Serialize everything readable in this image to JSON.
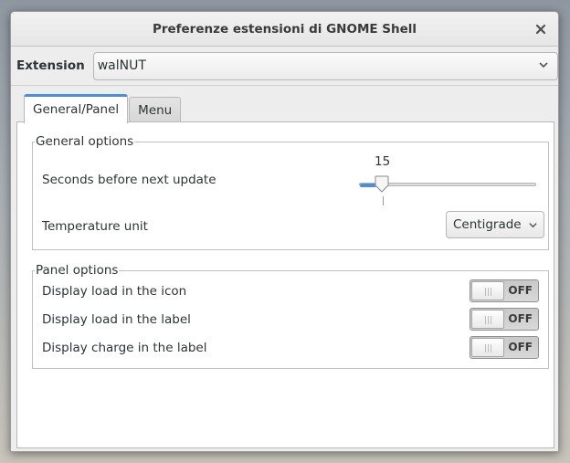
{
  "window": {
    "title": "Preferenze estensioni di GNOME Shell"
  },
  "extension": {
    "label": "Extension",
    "selected": "walNUT"
  },
  "tabs": [
    {
      "label": "General/Panel",
      "active": true
    },
    {
      "label": "Menu",
      "active": false
    }
  ],
  "general_options": {
    "title": "General options",
    "update_label": "Seconds before next update",
    "update_value": "15",
    "temperature_label": "Temperature unit",
    "temperature_value": "Centigrade"
  },
  "panel_options": {
    "title": "Panel options",
    "rows": [
      {
        "label": "Display load in the icon",
        "state": "OFF"
      },
      {
        "label": "Display load in the label",
        "state": "OFF"
      },
      {
        "label": "Display charge in the label",
        "state": "OFF"
      }
    ]
  },
  "icons": {
    "close": "close-icon",
    "dropdown": "chevron-down-icon"
  },
  "colors": {
    "accent": "#4a90d9"
  }
}
